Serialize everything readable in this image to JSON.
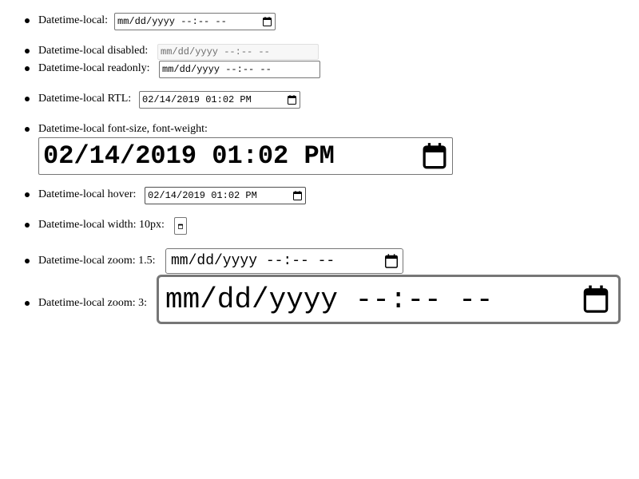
{
  "items": [
    {
      "label": "Datetime-local:",
      "value": "mm/dd/yyyy --:-- --"
    },
    {
      "label": "Datetime-local disabled:",
      "value": "mm/dd/yyyy --:-- --"
    },
    {
      "label": "Datetime-local readonly:",
      "value": "mm/dd/yyyy --:-- --"
    },
    {
      "label": "Datetime-local RTL:",
      "value": "02/14/2019 01:02 PM"
    },
    {
      "label": "Datetime-local font-size, font-weight:",
      "value": "02/14/2019 01:02 PM"
    },
    {
      "label": "Datetime-local hover:",
      "value": "02/14/2019 01:02 PM"
    },
    {
      "label": "Datetime-local width: 10px:",
      "value": ""
    },
    {
      "label": "Datetime-local zoom: 1.5:",
      "value": "mm/dd/yyyy --:-- --"
    },
    {
      "label": "Datetime-local zoom: 3:",
      "value": "mm/dd/yyyy --:-- --"
    }
  ],
  "icons": {
    "calendar": "calendar-icon"
  },
  "colors": {
    "border": "#767676",
    "disabled_border": "#e0e0e0",
    "disabled_bg": "#f7f7f7",
    "disabled_text": "#6d6d6d",
    "zoom3_border": "#767676"
  }
}
